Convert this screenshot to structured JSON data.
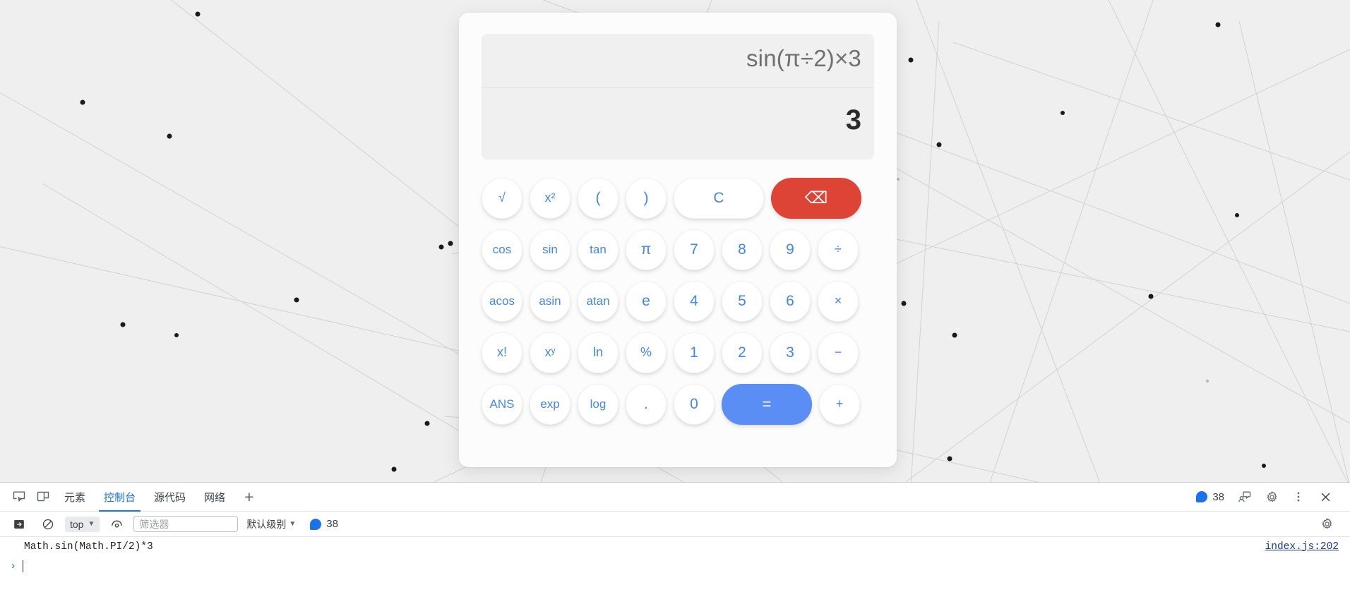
{
  "calculator": {
    "display": {
      "expression": "sin(π÷2)×3",
      "result": "3"
    },
    "rows": [
      [
        {
          "label": "√",
          "name": "key-sqrt",
          "style": "small"
        },
        {
          "label": "x²",
          "name": "key-square",
          "style": "small"
        },
        {
          "label": "(",
          "name": "key-open-paren",
          "style": ""
        },
        {
          "label": ")",
          "name": "key-close-paren",
          "style": ""
        },
        {
          "label": "C",
          "name": "key-clear",
          "style": "wide"
        },
        {
          "label": "⌫",
          "name": "key-backspace",
          "style": "wide danger"
        }
      ],
      [
        {
          "label": "cos",
          "name": "key-cos",
          "style": "tiny"
        },
        {
          "label": "sin",
          "name": "key-sin",
          "style": "tiny"
        },
        {
          "label": "tan",
          "name": "key-tan",
          "style": "tiny"
        },
        {
          "label": "π",
          "name": "key-pi",
          "style": ""
        },
        {
          "label": "7",
          "name": "key-7",
          "style": ""
        },
        {
          "label": "8",
          "name": "key-8",
          "style": ""
        },
        {
          "label": "9",
          "name": "key-9",
          "style": ""
        },
        {
          "label": "÷",
          "name": "key-divide",
          "style": "small"
        }
      ],
      [
        {
          "label": "acos",
          "name": "key-acos",
          "style": "tiny"
        },
        {
          "label": "asin",
          "name": "key-asin",
          "style": "tiny"
        },
        {
          "label": "atan",
          "name": "key-atan",
          "style": "tiny"
        },
        {
          "label": "e",
          "name": "key-e",
          "style": ""
        },
        {
          "label": "4",
          "name": "key-4",
          "style": ""
        },
        {
          "label": "5",
          "name": "key-5",
          "style": ""
        },
        {
          "label": "6",
          "name": "key-6",
          "style": ""
        },
        {
          "label": "×",
          "name": "key-multiply",
          "style": "small"
        }
      ],
      [
        {
          "label": "x!",
          "name": "key-factorial",
          "style": "small"
        },
        {
          "label": "xʸ",
          "name": "key-power",
          "style": "small"
        },
        {
          "label": "ln",
          "name": "key-ln",
          "style": "small"
        },
        {
          "label": "%",
          "name": "key-percent",
          "style": "small"
        },
        {
          "label": "1",
          "name": "key-1",
          "style": ""
        },
        {
          "label": "2",
          "name": "key-2",
          "style": ""
        },
        {
          "label": "3",
          "name": "key-3",
          "style": ""
        },
        {
          "label": "−",
          "name": "key-minus",
          "style": "small"
        }
      ],
      [
        {
          "label": "ANS",
          "name": "key-ans",
          "style": "tiny"
        },
        {
          "label": "exp",
          "name": "key-exp",
          "style": "tiny"
        },
        {
          "label": "log",
          "name": "key-log",
          "style": "tiny"
        },
        {
          "label": ".",
          "name": "key-decimal",
          "style": ""
        },
        {
          "label": "0",
          "name": "key-0",
          "style": ""
        },
        {
          "label": "=",
          "name": "key-equals",
          "style": "wide primary"
        },
        {
          "label": "+",
          "name": "key-plus",
          "style": "small"
        }
      ]
    ]
  },
  "devtools": {
    "tabs": [
      {
        "label": "元素",
        "name": "tab-elements",
        "active": false
      },
      {
        "label": "控制台",
        "name": "tab-console",
        "active": true
      },
      {
        "label": "源代码",
        "name": "tab-sources",
        "active": false
      },
      {
        "label": "网络",
        "name": "tab-network",
        "active": false
      }
    ],
    "more_tabs_label": "+",
    "message_count": "38",
    "toolbar": {
      "context": "top",
      "filter_placeholder": "筛选器",
      "filter_value": "",
      "level": "默认级别",
      "level_count": "38"
    },
    "console": {
      "entry": "Math.sin(Math.PI/2)*3",
      "source": "index.js:202",
      "prompt": "›",
      "input_value": ""
    }
  },
  "colors": {
    "accent": "#4285f4",
    "equals": "#5b8ef4",
    "danger": "#dd4436",
    "devtools_active": "#1a73e8",
    "background": "#efefef"
  }
}
